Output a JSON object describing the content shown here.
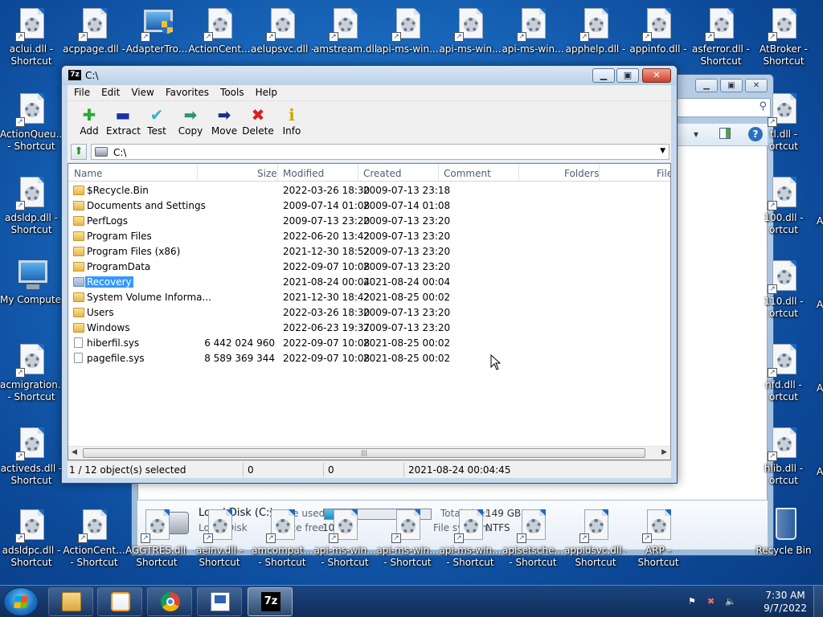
{
  "desktop": {
    "top_icons": [
      {
        "label1": "aclui.dll -",
        "label2": "Shortcut"
      },
      {
        "label1": "acppage.dll -",
        "label2": ""
      },
      {
        "label1": "AdapterTro...",
        "label2": ""
      },
      {
        "label1": "ActionCent...",
        "label2": ""
      },
      {
        "label1": "aelupsvc.dll -",
        "label2": ""
      },
      {
        "label1": "amstream.dll",
        "label2": ""
      },
      {
        "label1": "api-ms-win...",
        "label2": ""
      },
      {
        "label1": "api-ms-win...",
        "label2": ""
      },
      {
        "label1": "api-ms-win...",
        "label2": ""
      },
      {
        "label1": "apphelp.dll -",
        "label2": ""
      },
      {
        "label1": "appinfo.dll -",
        "label2": ""
      },
      {
        "label1": "asferror.dll -",
        "label2": "Shortcut"
      },
      {
        "label1": "AtBroker -",
        "label2": "Shortcut"
      }
    ],
    "left_icons": [
      {
        "label1": "ActionQueu...",
        "label2": "- Shortcut"
      },
      {
        "label1": "adsldp.dll -",
        "label2": "Shortcut"
      },
      {
        "label1": "My Computer",
        "label2": ""
      },
      {
        "label1": "acmigration...",
        "label2": "- Shortcut"
      },
      {
        "label1": "activeds.dll -",
        "label2": "Shortcut"
      }
    ],
    "bottom_icons": [
      {
        "label1": "adsldpc.dll -",
        "label2": "Shortcut"
      },
      {
        "label1": "ActionCent...",
        "label2": "- Shortcut"
      },
      {
        "label1": "AGGTRES.dll -",
        "label2": "Shortcut"
      },
      {
        "label1": "aeinv.dll -",
        "label2": "Shortcut"
      },
      {
        "label1": "amcompat...",
        "label2": "- Shortcut"
      },
      {
        "label1": "api-ms-win...",
        "label2": "- Shortcut"
      },
      {
        "label1": "api-ms-win...",
        "label2": "- Shortcut"
      },
      {
        "label1": "api-ms-win...",
        "label2": "- Shortcut"
      },
      {
        "label1": "apisetsche...",
        "label2": "- Shortcut"
      },
      {
        "label1": "appidsvc.dll -",
        "label2": "Shortcut"
      },
      {
        "label1": "ARP -",
        "label2": "Shortcut"
      },
      {
        "label1": "Recycle Bin",
        "label2": ""
      }
    ],
    "right_icons": [
      {
        "label1": "tl.dll -",
        "label2": "ortcut"
      },
      {
        "label1": "100.dll -",
        "label2": "ortcut"
      },
      {
        "label1": "110.dll -",
        "label2": "ortcut"
      },
      {
        "label1": "nfd.dll -",
        "label2": "ortcut"
      },
      {
        "label1": "hlib.dll -",
        "label2": "ortcut"
      }
    ],
    "partial_right_labels": [
      "A",
      "A",
      "A",
      "A"
    ]
  },
  "background_window": {
    "drive_name": "Local Disk (C:)",
    "drive_type": "Local Disk",
    "space_used_label": "Space used:",
    "space_used_fraction": 0.29,
    "space_free_label": "Space free:",
    "space_free_value": "106 GB",
    "total_size_label": "Total size:",
    "total_size_value": "149 GB",
    "filesystem_label": "File system:",
    "filesystem_value": "NTFS"
  },
  "zip_window": {
    "title": "C:\\",
    "app_icon": "7z",
    "menu": [
      "File",
      "Edit",
      "View",
      "Favorites",
      "Tools",
      "Help"
    ],
    "toolbar": [
      {
        "label": "Add",
        "icon": "plus-icon",
        "glyph": "✚",
        "color": "#2aa832"
      },
      {
        "label": "Extract",
        "icon": "minus-icon",
        "glyph": "▬",
        "color": "#1c2fa8"
      },
      {
        "label": "Test",
        "icon": "check-icon",
        "glyph": "✔",
        "color": "#2bb5c9"
      },
      {
        "label": "Copy",
        "icon": "copy-arrow-icon",
        "glyph": "➡",
        "color": "#2a9a6a"
      },
      {
        "label": "Move",
        "icon": "move-arrow-icon",
        "glyph": "➡",
        "color": "#162f8a"
      },
      {
        "label": "Delete",
        "icon": "delete-x-icon",
        "glyph": "✖",
        "color": "#d81f1f"
      },
      {
        "label": "Info",
        "icon": "info-icon",
        "glyph": "ℹ",
        "color": "#c8a800"
      }
    ],
    "address": "C:\\",
    "columns": [
      "Name",
      "Size",
      "Modified",
      "Created",
      "Comment",
      "Folders",
      "File"
    ],
    "rows": [
      {
        "name": "$Recycle.Bin",
        "size": "",
        "modified": "2022-03-26 18:30",
        "created": "2009-07-13 23:18",
        "kind": "folder"
      },
      {
        "name": "Documents and Settings",
        "size": "",
        "modified": "2009-07-14 01:08",
        "created": "2009-07-14 01:08",
        "kind": "folder"
      },
      {
        "name": "PerfLogs",
        "size": "",
        "modified": "2009-07-13 23:20",
        "created": "2009-07-13 23:20",
        "kind": "folder"
      },
      {
        "name": "Program Files",
        "size": "",
        "modified": "2022-06-20 13:42",
        "created": "2009-07-13 23:20",
        "kind": "folder"
      },
      {
        "name": "Program Files (x86)",
        "size": "",
        "modified": "2021-12-30 18:52",
        "created": "2009-07-13 23:20",
        "kind": "folder"
      },
      {
        "name": "ProgramData",
        "size": "",
        "modified": "2022-09-07 10:08",
        "created": "2009-07-13 23:20",
        "kind": "folder"
      },
      {
        "name": "Recovery",
        "size": "",
        "modified": "2021-08-24 00:04",
        "created": "2021-08-24 00:04",
        "kind": "folder-selected"
      },
      {
        "name": "System Volume Informa...",
        "size": "",
        "modified": "2021-12-30 18:42",
        "created": "2021-08-25 00:02",
        "kind": "folder"
      },
      {
        "name": "Users",
        "size": "",
        "modified": "2022-03-26 18:30",
        "created": "2009-07-13 23:20",
        "kind": "folder"
      },
      {
        "name": "Windows",
        "size": "",
        "modified": "2022-06-23 19:37",
        "created": "2009-07-13 23:20",
        "kind": "folder"
      },
      {
        "name": "hiberfil.sys",
        "size": "6 442 024 960",
        "modified": "2022-09-07 10:08",
        "created": "2021-08-25 00:02",
        "kind": "file"
      },
      {
        "name": "pagefile.sys",
        "size": "8 589 369 344",
        "modified": "2022-09-07 10:08",
        "created": "2021-08-25 00:02",
        "kind": "file"
      }
    ],
    "status": {
      "selection": "1 / 12 object(s) selected",
      "size": "0",
      "packed": "0",
      "date": "2021-08-24 00:04:45"
    }
  },
  "taskbar": {
    "items": [
      "explorer-icon",
      "media-player-icon",
      "chrome-icon",
      "wordpad-icon",
      "7zip-icon"
    ],
    "active_item": "7zip-icon",
    "time": "7:30 AM",
    "date": "9/7/2022"
  }
}
